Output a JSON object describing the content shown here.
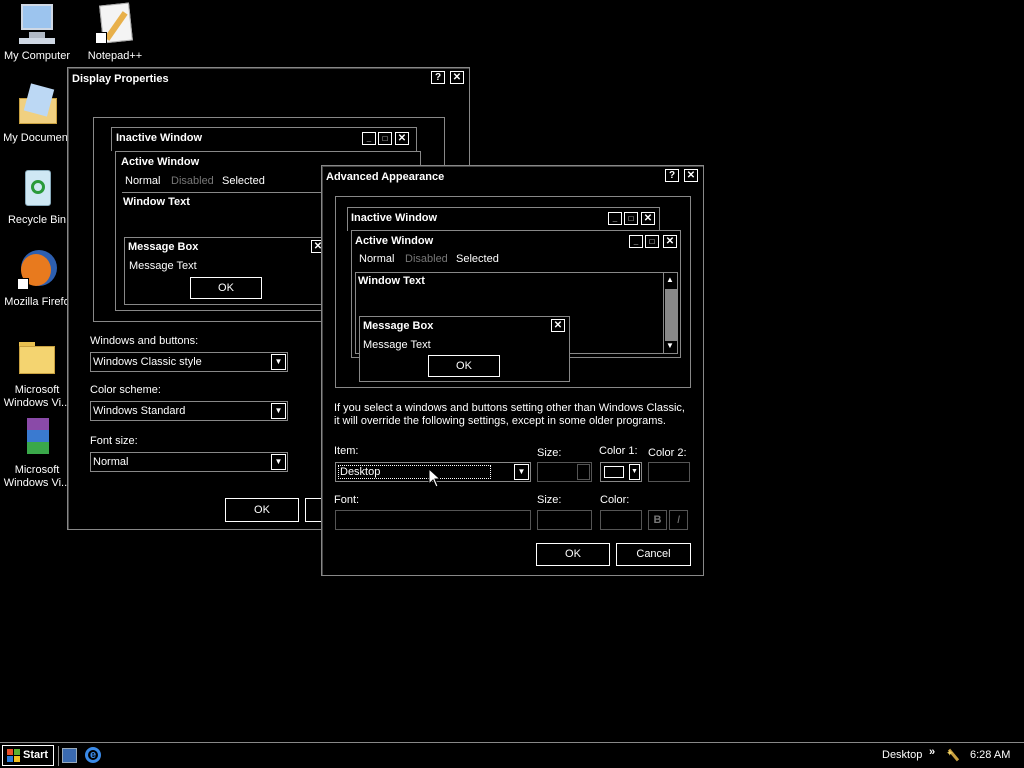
{
  "desktop": {
    "icons": [
      {
        "label": "My Computer",
        "icon": "computer-icon"
      },
      {
        "label": "Notepad++",
        "icon": "notepad-icon"
      },
      {
        "label": "My Document",
        "icon": "documents-icon"
      },
      {
        "label": "Recycle Bin",
        "icon": "recycle-bin-icon"
      },
      {
        "label": "Mozilla Firefo",
        "icon": "firefox-icon"
      },
      {
        "label": "Microsoft Windows Vi...",
        "icon": "folder-icon"
      },
      {
        "label": "Microsoft Windows Vi...",
        "icon": "winrar-icon"
      }
    ]
  },
  "display_properties": {
    "title": "Display Properties",
    "preview": {
      "inactive_title": "Inactive Window",
      "active_title": "Active Window",
      "menu_normal": "Normal",
      "menu_disabled": "Disabled",
      "menu_selected": "Selected",
      "window_text": "Window Text",
      "msgbox_title": "Message Box",
      "msgbox_text": "Message Text",
      "msgbox_ok": "OK"
    },
    "windows_buttons_label": "Windows and buttons:",
    "windows_buttons_value": "Windows Classic style",
    "color_scheme_label": "Color scheme:",
    "color_scheme_value": "Windows Standard",
    "font_size_label": "Font size:",
    "font_size_value": "Normal",
    "ok_label": "OK"
  },
  "advanced_appearance": {
    "title": "Advanced Appearance",
    "preview": {
      "inactive_title": "Inactive Window",
      "active_title": "Active Window",
      "menu_normal": "Normal",
      "menu_disabled": "Disabled",
      "menu_selected": "Selected",
      "window_text": "Window Text",
      "msgbox_title": "Message Box",
      "msgbox_text": "Message Text",
      "msgbox_ok": "OK"
    },
    "info_line1": "If you select a windows and buttons setting other than Windows Classic,",
    "info_line2": "it will override the following settings, except in some older programs.",
    "item_label": "Item:",
    "item_value": "Desktop",
    "size_label": "Size:",
    "color1_label": "Color 1:",
    "color2_label": "Color 2:",
    "font_label": "Font:",
    "font_size_label": "Size:",
    "font_color_label": "Color:",
    "bold_label": "B",
    "italic_label": "I",
    "ok_label": "OK",
    "cancel_label": "Cancel"
  },
  "taskbar": {
    "start_label": "Start",
    "desktop_label": "Desktop",
    "chevron": "»",
    "clock": "6:28 AM"
  }
}
